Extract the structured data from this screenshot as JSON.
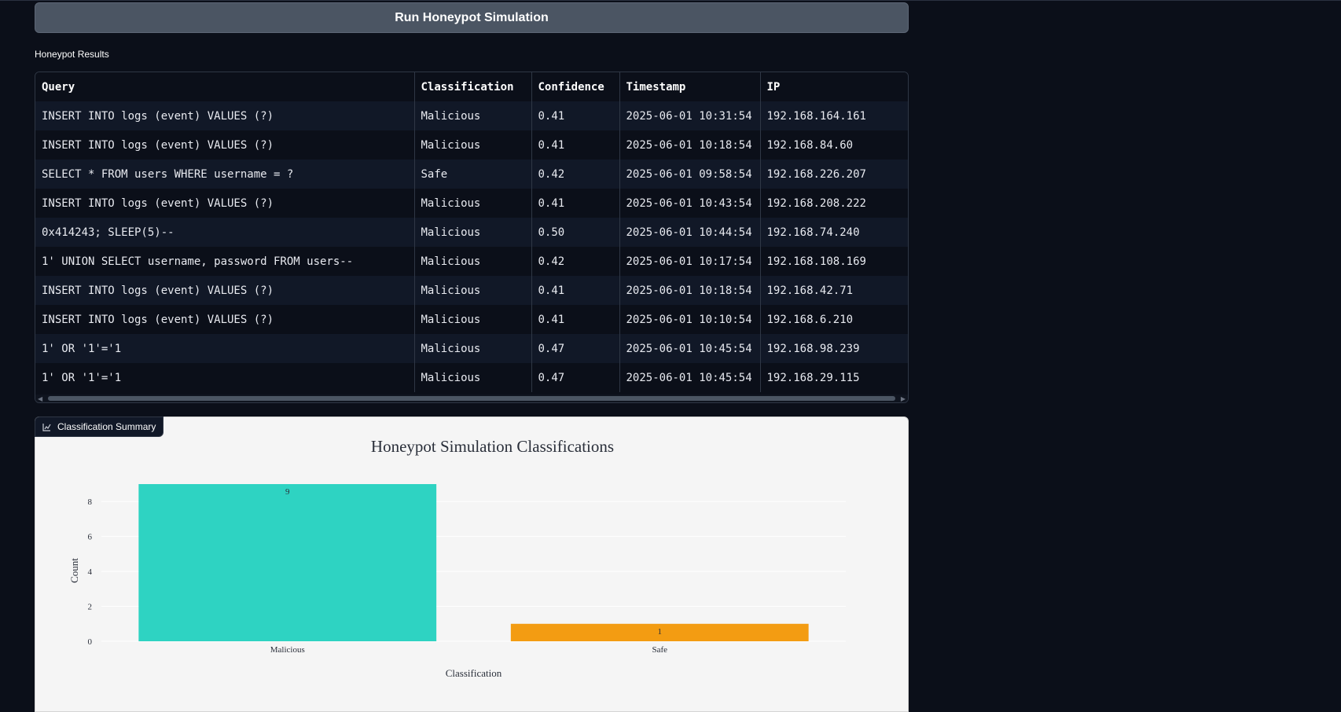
{
  "run_button": {
    "label": "Run Honeypot Simulation"
  },
  "results": {
    "label": "Honeypot Results",
    "columns": [
      "Query",
      "Classification",
      "Confidence",
      "Timestamp",
      "IP"
    ],
    "rows": [
      [
        "INSERT INTO logs (event) VALUES (?)",
        "Malicious",
        "0.41",
        "2025-06-01 10:31:54",
        "192.168.164.161"
      ],
      [
        "INSERT INTO logs (event) VALUES (?)",
        "Malicious",
        "0.41",
        "2025-06-01 10:18:54",
        "192.168.84.60"
      ],
      [
        "SELECT * FROM users WHERE username = ?",
        "Safe",
        "0.42",
        "2025-06-01 09:58:54",
        "192.168.226.207"
      ],
      [
        "INSERT INTO logs (event) VALUES (?)",
        "Malicious",
        "0.41",
        "2025-06-01 10:43:54",
        "192.168.208.222"
      ],
      [
        "0x414243; SLEEP(5)--",
        "Malicious",
        "0.50",
        "2025-06-01 10:44:54",
        "192.168.74.240"
      ],
      [
        "1' UNION SELECT username, password FROM users--",
        "Malicious",
        "0.42",
        "2025-06-01 10:17:54",
        "192.168.108.169"
      ],
      [
        "INSERT INTO logs (event) VALUES (?)",
        "Malicious",
        "0.41",
        "2025-06-01 10:18:54",
        "192.168.42.71"
      ],
      [
        "INSERT INTO logs (event) VALUES (?)",
        "Malicious",
        "0.41",
        "2025-06-01 10:10:54",
        "192.168.6.210"
      ],
      [
        "1' OR '1'='1",
        "Malicious",
        "0.47",
        "2025-06-01 10:45:54",
        "192.168.98.239"
      ],
      [
        "1' OR '1'='1",
        "Malicious",
        "0.47",
        "2025-06-01 10:45:54",
        "192.168.29.115"
      ]
    ]
  },
  "summary_tab": {
    "label": "Classification Summary",
    "icon": "chart-icon"
  },
  "colors": {
    "malicious": "#2ed3c2",
    "safe": "#f39c12"
  },
  "chart_data": {
    "type": "bar",
    "title": "Honeypot Simulation Classifications",
    "xlabel": "Classification",
    "ylabel": "Count",
    "categories": [
      "Malicious",
      "Safe"
    ],
    "values": [
      9,
      1
    ],
    "bar_colors": [
      "#2ed3c2",
      "#f39c12"
    ],
    "ylim": [
      0,
      9
    ],
    "yticks": [
      0,
      2,
      4,
      6,
      8
    ],
    "grid": true
  }
}
